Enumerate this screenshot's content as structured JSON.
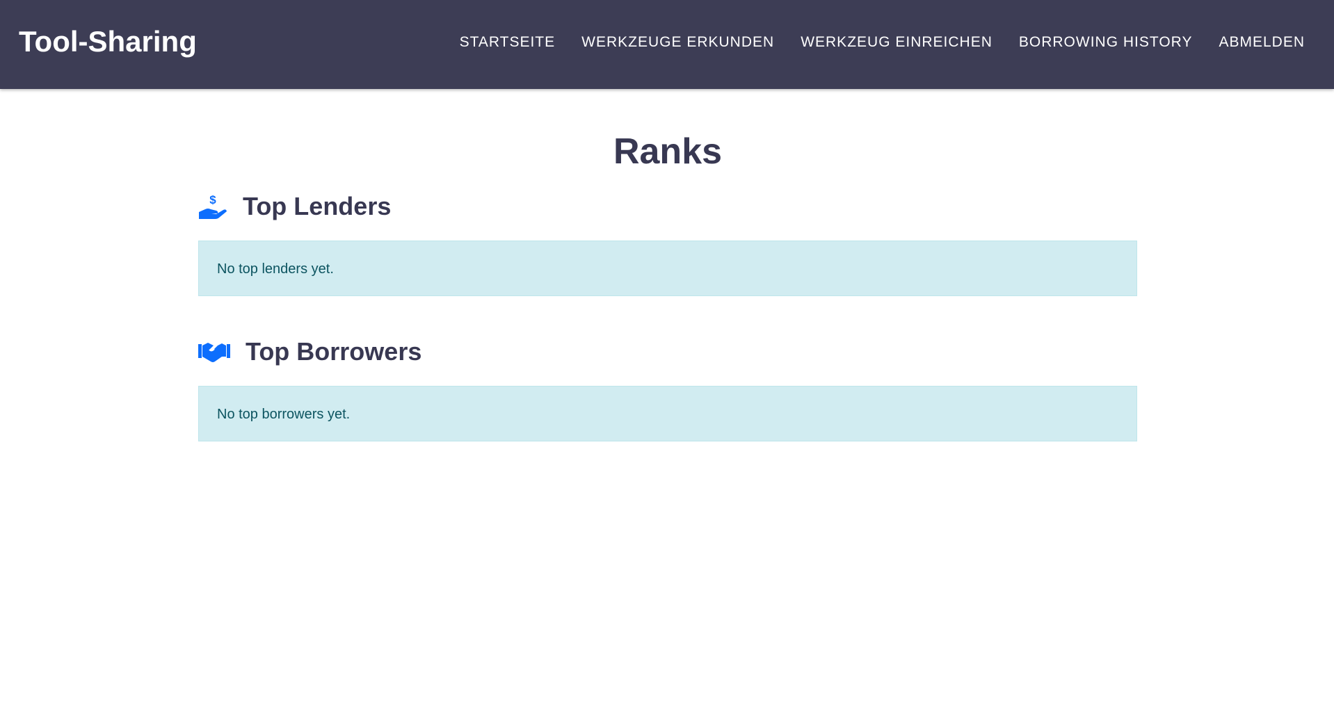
{
  "header": {
    "brand": "Tool-Sharing",
    "nav": [
      {
        "label": "Startseite"
      },
      {
        "label": "Werkzeuge erkunden"
      },
      {
        "label": "Werkzeug einreichen"
      },
      {
        "label": "Borrowing History"
      },
      {
        "label": "Abmelden"
      }
    ]
  },
  "main": {
    "title": "Ranks",
    "lenders": {
      "heading": "Top Lenders",
      "icon": "hand-holding-dollar-icon",
      "empty_message": "No top lenders yet."
    },
    "borrowers": {
      "heading": "Top Borrowers",
      "icon": "handshake-icon",
      "empty_message": "No top borrowers yet."
    }
  },
  "colors": {
    "navbar": "#3d3d55",
    "heading": "#383852",
    "icon": "#0d6efd",
    "alert_bg": "#d1ecf1",
    "alert_text": "#0c5460"
  }
}
